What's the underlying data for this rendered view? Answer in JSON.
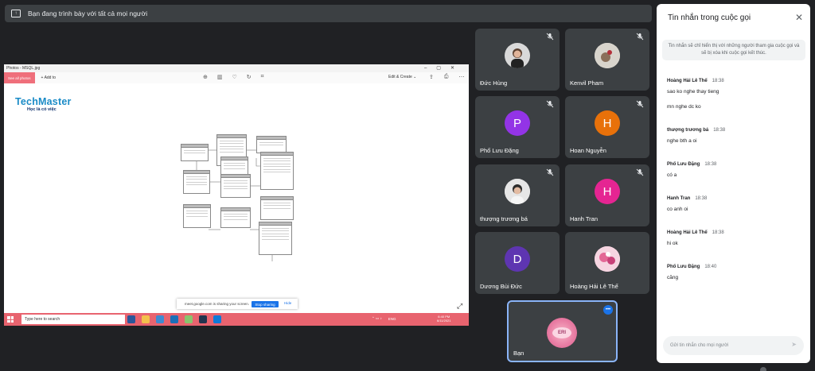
{
  "present_bar": {
    "text": "Bạn đang trình bày với tất cả mọi người",
    "icon": "present-screen-icon"
  },
  "shared_screen": {
    "window_title": "Photos - MSQL.jpg",
    "toolbar": {
      "see_all": "See all photos",
      "add_to": "+ Add to",
      "edit_create": "Edit & Create ⌄"
    },
    "logo": {
      "brand": "TechMaster",
      "tagline": "Học là có việc"
    },
    "share_banner": {
      "text": "meet.google.com is sharing your screen.",
      "stop": "Stop sharing",
      "hide": "Hide"
    },
    "taskbar": {
      "search_placeholder": "Type here to search",
      "tray_lang": "ENG",
      "time": "6:40 PM",
      "date": "6/11/2021"
    }
  },
  "participants": [
    {
      "name": "Đức Hùng",
      "avatar_type": "photo",
      "avatar_color": "#d9d9d9"
    },
    {
      "name": "Kenvil Pham",
      "avatar_type": "photo",
      "avatar_color": "#c9c9c9"
    },
    {
      "name": "Phố Lưu Đặng",
      "initial": "P",
      "avatar_color": "#9334e6"
    },
    {
      "name": "Hoan Nguyễn",
      "initial": "H",
      "avatar_color": "#e8710a"
    },
    {
      "name": "thượng trương bá",
      "avatar_type": "photo",
      "avatar_color": "#cfcfcf"
    },
    {
      "name": "Hanh Tran",
      "initial": "H",
      "avatar_color": "#e52592"
    },
    {
      "name": "Dương Bùi Đức",
      "initial": "D",
      "avatar_color": "#5e35b1"
    },
    {
      "name": "Hoàng Hải Lê Thế",
      "avatar_type": "photo",
      "avatar_color": "#f4c7d8"
    }
  ],
  "self_tile": {
    "name": "Bạn",
    "badge_text": "ERI"
  },
  "chat": {
    "title": "Tin nhắn trong cuộc gọi",
    "notice": "Tin nhắn sẽ chỉ hiển thị với những người tham gia cuộc gọi và sẽ bị xóa khi cuộc gọi kết thúc.",
    "messages": [
      {
        "sender": "Hoàng Hải Lê Thế",
        "time": "18:38",
        "text": "sao ko nghe thay tieng",
        "extra": "mn nghe dc ko"
      },
      {
        "sender": "thượng trương bá",
        "time": "18:38",
        "text": "nghe bth a oi"
      },
      {
        "sender": "Phố Lưu Đặng",
        "time": "18:38",
        "text": "có a"
      },
      {
        "sender": "Hanh Tran",
        "time": "18:38",
        "text": "co anh oi"
      },
      {
        "sender": "Hoàng Hải Lê Thế",
        "time": "18:38",
        "text": "hi ok"
      },
      {
        "sender": "Phố Lưu Đặng",
        "time": "18:40",
        "text": "căng"
      }
    ],
    "input_placeholder": "Gửi tin nhắn cho mọi người"
  }
}
